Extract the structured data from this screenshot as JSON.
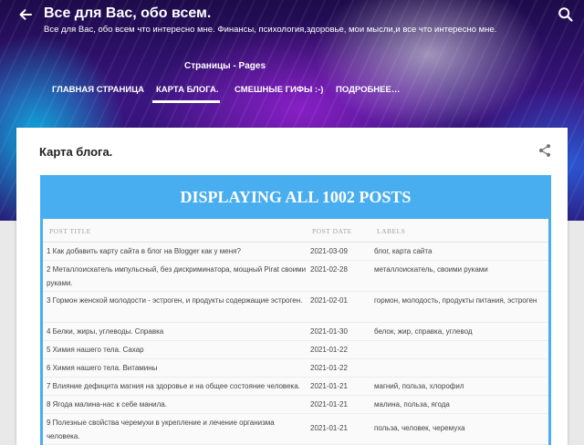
{
  "header": {
    "site_title": "Все для Вас, обо всем.",
    "site_description": "Все для Вас, обо всем что интересно мне. Финансы, психология,здоровье, мои мысли,и все что интересно мне.",
    "pages_title": "Страницы - Pages",
    "nav": [
      {
        "label": "ГЛАВНАЯ СТРАНИЦА",
        "active": false
      },
      {
        "label": "КАРТА БЛОГА.",
        "active": true
      },
      {
        "label": "СМЕШНЫЕ ГИФЫ :-)",
        "active": false
      },
      {
        "label": "ПОДРОБНЕЕ…",
        "active": false
      }
    ]
  },
  "post": {
    "title": "Карта блога."
  },
  "sitemap": {
    "heading": "DISPLAYING ALL 1002 POSTS",
    "columns": [
      "POST TITLE",
      "POST DATE",
      "LABELS"
    ],
    "rows": [
      {
        "title": "1  Как добавить карту сайта в блог на Blogger как у меня?",
        "date": "2021-03-09",
        "labels": "блог, карта сайта"
      },
      {
        "title": "2  Металлоискатель импульсный, без дискриминатора, мощный Pirat своими руками.",
        "date": "2021-02-28",
        "labels": "металлоискатель, своими руками"
      },
      {
        "title": "3  Гормон женской молодости - эстроген, и продукты содержащие эстроген.",
        "date": "2021-02-01",
        "labels": "гормон, молодость, продукты питания, эстроген"
      },
      {
        "title": "4   Белки, жиры, углеводы. Справка",
        "date": "2021-01-30",
        "labels": "белок, жир, справка, углевод"
      },
      {
        "title": "5  Химия нашего тела. Сахар",
        "date": "2021-01-22",
        "labels": ""
      },
      {
        "title": "6  Химия нашего тела. Витамины",
        "date": "2021-01-22",
        "labels": ""
      },
      {
        "title": "7  Влияние дефицита магния на здоровье и на общее состояние человека.",
        "date": "2021-01-21",
        "labels": "магний, польза, хлорофил"
      },
      {
        "title": "8  Ягода малина-нас к себе манила.",
        "date": "2021-01-21",
        "labels": "малина, польза, ягода"
      },
      {
        "title": "9   Полезные свойства черемухи в укрепление и лечение организма человека.",
        "date": "2021-01-21",
        "labels": "польза, человек, черемуха"
      }
    ]
  },
  "icons": {
    "back": "arrow-back-icon",
    "search": "search-icon",
    "share": "share-icon"
  },
  "colors": {
    "sitemap_accent": "#49aeef",
    "header_dark": "#2a0f6e"
  }
}
